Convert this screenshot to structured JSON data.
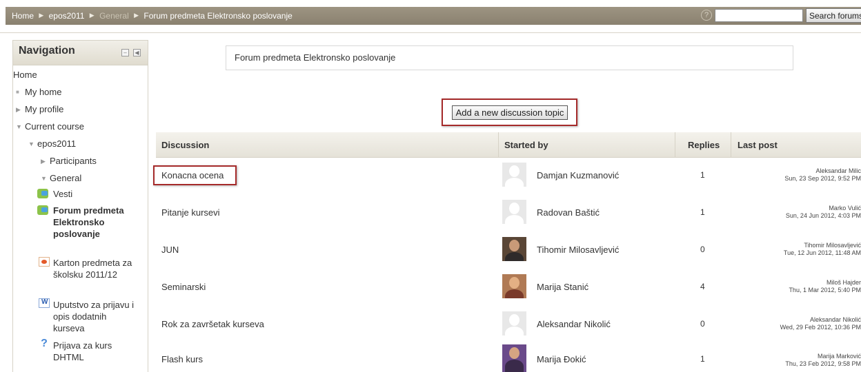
{
  "breadcrumb": {
    "home": "Home",
    "course": "epos2011",
    "section": "General",
    "current": "Forum predmeta Elektronsko poslovanje"
  },
  "search": {
    "button_label": "Search forums",
    "placeholder": ""
  },
  "navigation": {
    "title": "Navigation",
    "items": {
      "home": "Home",
      "my_home": "My home",
      "my_profile": "My profile",
      "current_course": "Current course",
      "course": "epos2011",
      "participants": "Participants",
      "general": "General",
      "vesti": "Vesti",
      "forum": "Forum predmeta Elektronsko poslovanje",
      "karton": "Karton predmeta za školsku 2011/12",
      "uputstvo": "Uputstvo za prijavu i opis dodatnih kurseva",
      "prijava": "Prijava za kurs DHTML"
    }
  },
  "forum": {
    "intro": "Forum predmeta Elektronsko poslovanje",
    "add_button": "Add a new discussion topic"
  },
  "table": {
    "headers": {
      "discussion": "Discussion",
      "started_by": "Started by",
      "replies": "Replies",
      "last_post": "Last post"
    },
    "rows": [
      {
        "topic": "Konacna ocena",
        "author": "Damjan Kuzmanović",
        "replies": "1",
        "last_name": "Aleksandar Milic",
        "last_date": "Sun, 23 Sep 2012, 9:52 PM"
      },
      {
        "topic": "Pitanje kursevi",
        "author": "Radovan Baštić",
        "replies": "1",
        "last_name": "Marko Vulić",
        "last_date": "Sun, 24 Jun 2012, 4:03 PM"
      },
      {
        "topic": "JUN",
        "author": "Tihomir Milosavljević",
        "replies": "0",
        "last_name": "Tihomir Milosavljević",
        "last_date": "Tue, 12 Jun 2012, 11:48 AM"
      },
      {
        "topic": "Seminarski",
        "author": "Marija Stanić",
        "replies": "4",
        "last_name": "Miloš Hajder",
        "last_date": "Thu, 1 Mar 2012, 5:40 PM"
      },
      {
        "topic": "Rok za završetak kurseva",
        "author": "Aleksandar Nikolić",
        "replies": "0",
        "last_name": "Aleksandar Nikolić",
        "last_date": "Wed, 29 Feb 2012, 10:36 PM"
      },
      {
        "topic": "Flash kurs",
        "author": "Marija Đokić",
        "replies": "1",
        "last_name": "Marija Marković",
        "last_date": "Thu, 23 Feb 2012, 9:58 PM"
      }
    ]
  }
}
